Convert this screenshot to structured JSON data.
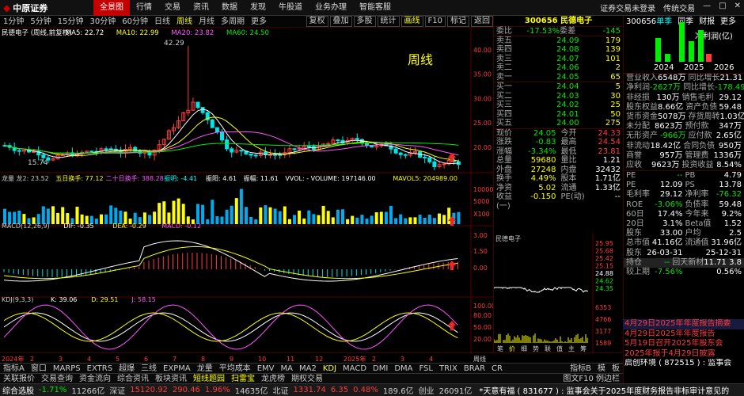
{
  "app": {
    "logo_text": "中原证券"
  },
  "top_menu": [
    {
      "label": "全景图"
    },
    {
      "label": "行情"
    },
    {
      "label": "交易"
    },
    {
      "label": "资讯"
    },
    {
      "label": "数据"
    },
    {
      "label": "发现"
    },
    {
      "label": "牛股道"
    },
    {
      "label": "业务办理"
    },
    {
      "label": "智能客服"
    }
  ],
  "top_tools": {
    "login": "证券交易未登录",
    "trade": "传统交易"
  },
  "period_tabs": [
    "1分钟",
    "5分钟",
    "15分钟",
    "30分钟",
    "60分钟",
    "日线",
    "周线",
    "月线",
    "多周期",
    "更多"
  ],
  "active_period": "周线",
  "chart_tools": [
    "复权",
    "叠加",
    "多股",
    "统计",
    "画线",
    "F10",
    "标记",
    "返回"
  ],
  "chart_info": {
    "title": "民德电子 (周线,前复权)",
    "ma5": "MA5: 22.72",
    "ma10": "MA10: 22.99",
    "ma20": "MA20: 23.82",
    "ma60": "MA60: 24.50",
    "period_overlay": "周线",
    "high_label": "42.29",
    "low_label": "15.74",
    "price_axis": [
      "40.00",
      "35.00",
      "30.00",
      "25.00",
      "20.00"
    ]
  },
  "volume_info": {
    "items": [
      "龙量 龙2: 23.52",
      "五日换手: 77.12",
      "二十日换手: 388.28",
      "振明: -4.41",
      "振阳: 4.61",
      "振幅: 11.61",
      "VVOL: - VOLUME: 197146.00",
      "MAVOL5: 204989.00"
    ],
    "axis": [
      "10000",
      "5000",
      "X100"
    ]
  },
  "macd_info": {
    "items": [
      "MACD(12,26,9)",
      "DIF: -0.35",
      "DEA: -0.29",
      "MACD: -0.12"
    ],
    "axis": [
      "3.00",
      "1.50",
      "0.00"
    ]
  },
  "kdj_info": {
    "items": [
      "KDJ(9,3,3)",
      "K: 39.06",
      "D: 29.51",
      "J: 58.15"
    ],
    "axis": [
      "100.00",
      "80.00",
      "50.00",
      "20.00"
    ]
  },
  "x_axis": {
    "labels": [
      "2024年",
      "2",
      "3",
      "4",
      "5",
      "6",
      "7",
      "8",
      "9",
      "10",
      "11",
      "12",
      "2025年",
      "2",
      "3",
      "4"
    ],
    "mode": "周线"
  },
  "bottom_tabs_1": [
    "指标A",
    "窗口",
    "MARPS",
    "EXTRS",
    "超爆",
    "三线",
    "EXPMA",
    "龙量",
    "平均成本",
    "EMV",
    "MA",
    "MA2",
    "KDJ",
    "MACD",
    "DMI",
    "DMA",
    "FSL",
    "TRIX",
    "BRAR",
    "CR"
  ],
  "bottom_tabs_1_right": [
    "指标B",
    "模",
    "板"
  ],
  "bottom_tabs_2": [
    "关联报价",
    "交易查询",
    "资金流向",
    "综合资讯",
    "板块资讯",
    "短线题园",
    "扫雷宝",
    "龙虎榜",
    "期权交易"
  ],
  "bottom_tabs_2_right": "图文F10 例边栏",
  "quote": {
    "code": "300656",
    "name": "民德电子",
    "weibi": "-17.53%",
    "weicha": "-145",
    "sell": [
      {
        "label": "卖五",
        "price": "24.09",
        "vol": "179"
      },
      {
        "label": "卖四",
        "price": "24.08",
        "vol": "139"
      },
      {
        "label": "卖三",
        "price": "24.07",
        "vol": "101"
      },
      {
        "label": "卖二",
        "price": "24.06",
        "vol": "2"
      },
      {
        "label": "卖一",
        "price": "24.05",
        "vol": "65"
      }
    ],
    "buy": [
      {
        "label": "买一",
        "price": "24.04",
        "vol": "5"
      },
      {
        "label": "买二",
        "price": "24.03",
        "vol": "30"
      },
      {
        "label": "买三",
        "price": "24.02",
        "vol": "25"
      },
      {
        "label": "买四",
        "price": "24.01",
        "vol": "50"
      },
      {
        "label": "买五",
        "price": "24.00",
        "vol": "275"
      }
    ],
    "stats": [
      {
        "l1": "现价",
        "v1": "24.05",
        "l2": "今开",
        "v2": "24.33"
      },
      {
        "l1": "涨跌",
        "v1": "-0.83",
        "l2": "最高",
        "v2": "24.54"
      },
      {
        "l1": "涨幅",
        "v1": "-3.34%",
        "l2": "最低",
        "v2": "23.81"
      },
      {
        "l1": "总量",
        "v1": "59680",
        "l2": "量比",
        "v2": "1.21"
      },
      {
        "l1": "外盘",
        "v1": "27248",
        "l2": "内盘",
        "v2": "32432"
      },
      {
        "l1": "换手",
        "v1": "4.49%",
        "l2": "股本",
        "v2": "1.71亿"
      },
      {
        "l1": "净资",
        "v1": "5.02",
        "l2": "流通",
        "v2": "1.33亿"
      },
      {
        "l1": "收益(一)",
        "v1": "-0.150",
        "l2": "PE(动)",
        "v2": "--"
      }
    ]
  },
  "mini_chart": {
    "title": "民德电子",
    "prices": [
      "25.95",
      "25.68",
      "25.42",
      "25.15",
      "24.88",
      "24.62",
      "24.35"
    ],
    "vol": [
      "6353",
      "4766",
      "3177",
      "1589"
    ],
    "tabs": [
      "笔",
      "价",
      "细",
      "势",
      "联",
      "值",
      "主",
      "筹"
    ]
  },
  "right_panel": {
    "code": "300656",
    "tabs": [
      "单季",
      "同季",
      "财报",
      "更多"
    ],
    "chart_title": "净利润(亿)",
    "years": [
      "2024",
      "2025",
      "2026"
    ],
    "rows": [
      {
        "a": "营业收入",
        "b": "6548万",
        "c": "同比增长",
        "d": "21.31"
      },
      {
        "a": "净利润",
        "b": "-2627万",
        "c": "同比增长",
        "d": "-178.49"
      },
      {
        "a": "非经损",
        "b": "130万",
        "c": "销售毛利",
        "d": "29.12"
      },
      {
        "a": "股东权益",
        "b": "8.66亿",
        "c": "资产负债",
        "d": "59.48"
      },
      {
        "a": "货币资金",
        "b": "5078万",
        "c": "存货周转",
        "d": "1.03亿"
      },
      {
        "a": "未分配",
        "b": "8623万",
        "c": "预付款",
        "d": "347万"
      },
      {
        "a": "无形资产",
        "b": "-966万",
        "c": "应付款",
        "d": "2.65亿"
      },
      {
        "a": "非流动",
        "b": "18.42亿",
        "c": "合同负债",
        "d": "950万"
      },
      {
        "a": "商誉",
        "b": "957万",
        "c": "管理费",
        "d": "1336万"
      },
      {
        "a": "应收",
        "b": "9623万",
        "c": "投资收益",
        "d": "8.54%"
      }
    ],
    "rows2": [
      {
        "a": "PE",
        "b": "--",
        "c": "PB",
        "d": "4.79"
      },
      {
        "a": "PE",
        "b": "12.09",
        "c": "PS",
        "d": "13.78"
      },
      {
        "a": "毛利率",
        "b": "29.12",
        "c": "净利率",
        "d": "-76.32"
      },
      {
        "a": "ROE",
        "b": "-3.06%",
        "c": "负债率",
        "d": "59.48"
      },
      {
        "a": "60日",
        "b": "17.4%",
        "c": "今年来",
        "d": "9.2%"
      },
      {
        "a": "20日",
        "b": "3.1%",
        "c": "Beta值",
        "d": "1.52"
      },
      {
        "a": "股东",
        "b": "33.00",
        "c": "户均",
        "d": "2.5"
      },
      {
        "a": "总市值",
        "b": "41.16亿",
        "c": "流通值",
        "d": "31.96亿"
      },
      {
        "a": "股东",
        "b": "26-03-31",
        "c": "",
        "d": "25-12-31"
      },
      {
        "a": "持仓",
        "b": "--",
        "c": "回天新材",
        "d": "11.71 3.8"
      },
      {
        "a": "较上期",
        "b": "-7.56%",
        "c": "",
        "d": "0.56%"
      }
    ]
  },
  "news": [
    "4月29日2025年年度报告摘要",
    "4月29日2025年年度报告",
    "5月19日召开2025年股东会",
    "2025年报于4月29日披露",
    "启创环境 ( 872515 ) : 监事会"
  ],
  "status_bar": {
    "items": [
      "综合选股",
      "-1.71%",
      "11266亿",
      "深证",
      "15120.92",
      "290.46",
      "1.96%",
      "14635亿",
      "北证",
      "1331.74",
      "6.35",
      "0.48%",
      "189.6亿",
      "创业",
      "26091亿"
    ],
    "ticker": "*天意有福 ( 831677 ) : 监事会关于2025年度财务报告非标审计意见的"
  },
  "colors": {
    "up": "#ff3c3c",
    "down": "#00e600",
    "accent": "#c40000",
    "ma5": "#ffffff",
    "ma10": "#ffff00",
    "ma20": "#ff50ff",
    "ma60": "#00e600"
  }
}
